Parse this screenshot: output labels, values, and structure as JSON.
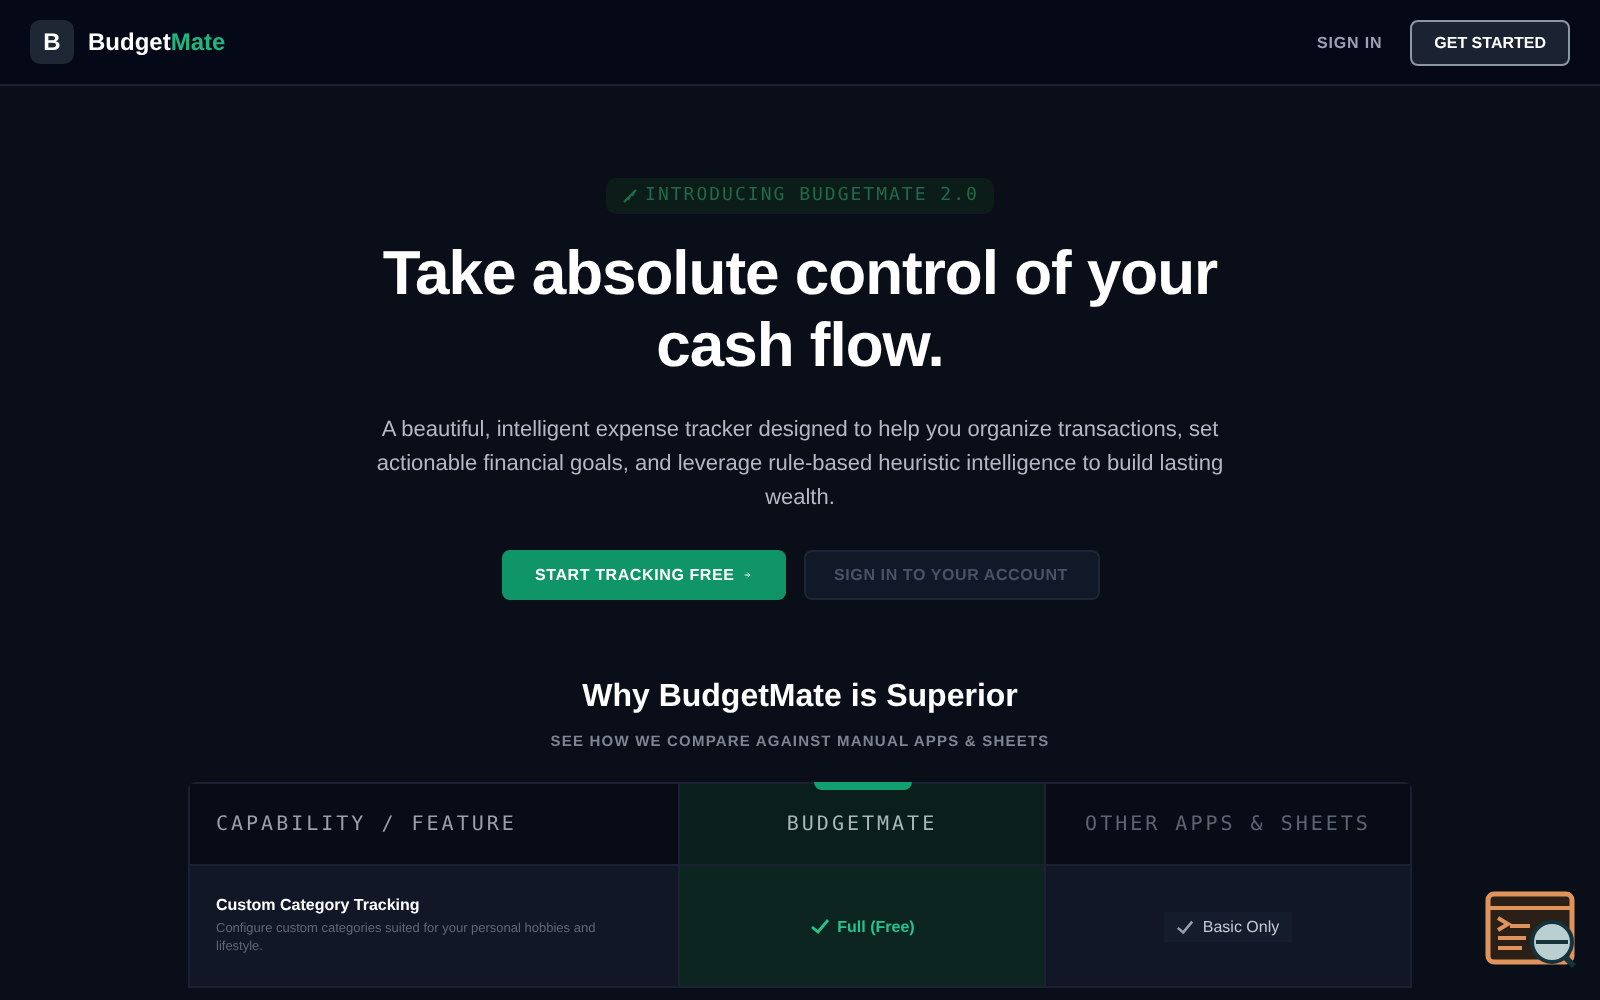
{
  "nav": {
    "logo_letter": "B",
    "brand": "Budget",
    "brand_accent": "Mate",
    "links": [
      {
        "label": "SIGN IN",
        "kind": "link"
      },
      {
        "label": "GET STARTED",
        "kind": "outline"
      }
    ]
  },
  "hero": {
    "badge": "INTRODUCING BUDGETMATE 2.0",
    "title_lines": [
      "Take absolute control of your",
      "cash flow."
    ],
    "description": "A beautiful, intelligent expense tracker designed to help you organize transactions, set actionable financial goals, and leverage rule-based heuristic intelligence to build lasting wealth.",
    "buttons": [
      {
        "label": "START TRACKING FREE",
        "kind": "primary"
      },
      {
        "label": "SIGN IN TO YOUR ACCOUNT",
        "kind": "ghost"
      }
    ]
  },
  "comparison": {
    "title": "Why BudgetMate is Superior",
    "subtitle": "SEE HOW WE COMPARE AGAINST MANUAL APPS & SHEETS",
    "columns": [
      {
        "label": "CAPABILITY / FEATURE",
        "highlight": false
      },
      {
        "label": "BUDGETMATE",
        "highlight": true
      },
      {
        "label": "OTHER APPS & SHEETS",
        "highlight": false
      }
    ],
    "rows": [
      {
        "feature": "Custom Category Tracking",
        "detail": "Configure custom categories suited for your personal hobbies and lifestyle.",
        "budgetmate": "Full (Free)",
        "others": "Basic Only"
      }
    ]
  }
}
